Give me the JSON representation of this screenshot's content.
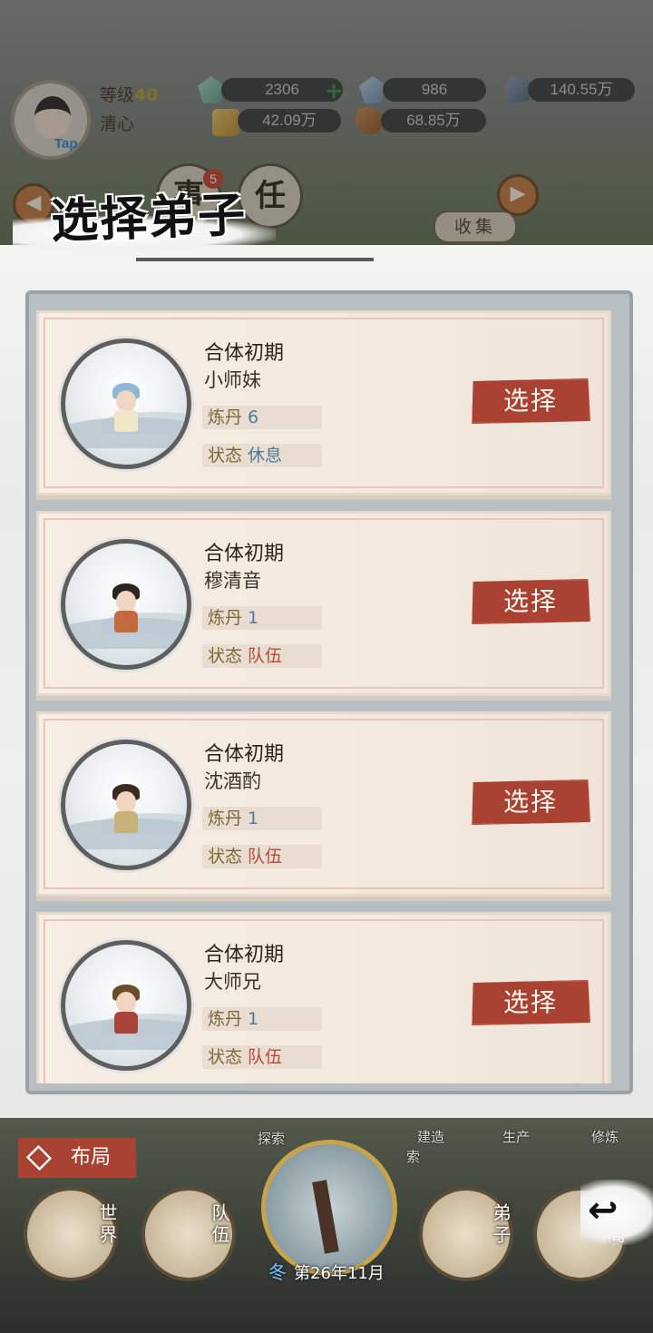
{
  "header": {
    "level_label": "等级",
    "level_value": "40",
    "player_name": "清心",
    "avatar_tag": "Tap",
    "resources": [
      {
        "icon": "green-gem-icon",
        "value": "2306",
        "has_plus": true
      },
      {
        "icon": "blue-gem-icon",
        "value": "986"
      },
      {
        "icon": "grey-stone-icon",
        "value": "140.55万"
      },
      {
        "icon": "gold-ingot-icon",
        "value": "42.09万"
      },
      {
        "icon": "copper-ore-icon",
        "value": "68.85万"
      }
    ],
    "plus_symbol": "+"
  },
  "background_nav": {
    "badge_count": "5",
    "btn_event": "事",
    "btn_task": "任",
    "collect_label": "收集"
  },
  "modal": {
    "title": "选择弟子",
    "disciples": [
      {
        "realm": "合体初期",
        "name": "小师妹",
        "skill_key": "炼丹",
        "skill_value": "6",
        "status_key": "状态",
        "status_value": "休息",
        "status_color": "#4d7a9e",
        "hair": "#8fb8d8",
        "robe": "#f0e6c8",
        "select_label": "选择"
      },
      {
        "realm": "合体初期",
        "name": "穆清音",
        "skill_key": "炼丹",
        "skill_value": "1",
        "status_key": "状态",
        "status_value": "队伍",
        "status_color": "#b84a3b",
        "hair": "#2b2522",
        "robe": "#c56a3e",
        "select_label": "选择"
      },
      {
        "realm": "合体初期",
        "name": "沈酒酌",
        "skill_key": "炼丹",
        "skill_value": "1",
        "status_key": "状态",
        "status_value": "队伍",
        "status_color": "#b84a3b",
        "hair": "#3b2a22",
        "robe": "#c9b27a",
        "select_label": "选择"
      },
      {
        "realm": "合体初期",
        "name": "大师兄",
        "skill_key": "炼丹",
        "skill_value": "1",
        "status_key": "状态",
        "status_value": "队伍",
        "status_color": "#b84a3b",
        "hair": "#6b4d2a",
        "robe": "#a8443a",
        "select_label": "选择"
      }
    ]
  },
  "bottom": {
    "layout_label": "布局",
    "menu": [
      {
        "label": "世界",
        "icon": "scroll-map-icon"
      },
      {
        "label": "队伍",
        "icon": "team-flag-icon"
      },
      {
        "label": "弟子",
        "icon": "disciple-icon"
      },
      {
        "label": "宝阁",
        "icon": "treasure-pavilion-icon"
      }
    ],
    "season": "冬",
    "date": "第26年11月",
    "tags": [
      "探索",
      "建造",
      "生产",
      "修炼",
      "索"
    ],
    "back_symbol": "↩"
  }
}
